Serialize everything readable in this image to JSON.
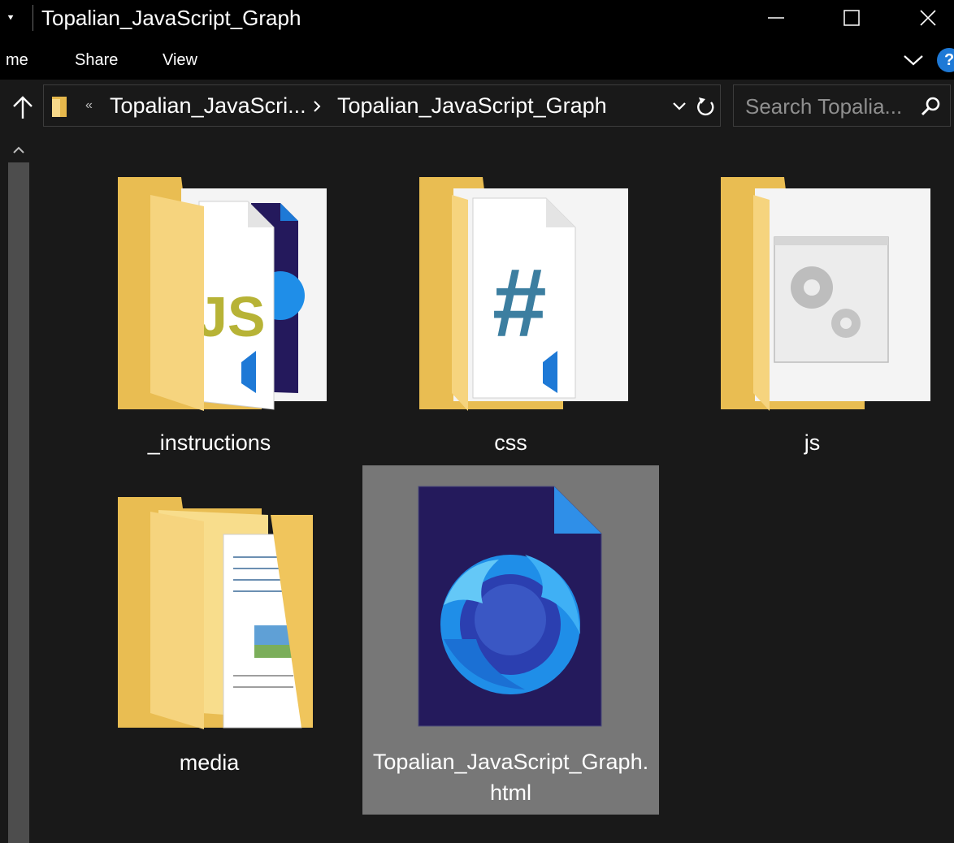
{
  "window": {
    "title": "Topalian_JavaScript_Graph",
    "quick_access_glyph": "⯆"
  },
  "ribbon": {
    "tabs": [
      "me",
      "Share",
      "View"
    ],
    "help_label": "?"
  },
  "address": {
    "overflow_glyph": "«",
    "crumbs": [
      "Topalian_JavaScri...",
      "Topalian_JavaScript_Graph"
    ]
  },
  "search": {
    "placeholder": "Search Topalia..."
  },
  "items": [
    {
      "label": "_instructions",
      "type": "folder",
      "icon": "folder-with-js-file-icon",
      "selected": false
    },
    {
      "label": "css",
      "type": "folder",
      "icon": "folder-with-css-file-icon",
      "selected": false
    },
    {
      "label": "js",
      "type": "folder",
      "icon": "folder-with-gears-icon",
      "selected": false
    },
    {
      "label": "media",
      "type": "folder",
      "icon": "folder-with-documents-icon",
      "selected": false
    },
    {
      "label_line1": "Topalian_JavaScript_Graph.",
      "label_line2": "html",
      "type": "file",
      "icon": "firefox-html-file-icon",
      "selected": true
    }
  ],
  "colors": {
    "titlebar": "#000000",
    "background": "#191919",
    "folder": "#f3d47c",
    "folder_dark": "#e6b84c",
    "selection": "#777777",
    "accent_blue": "#1e79d6"
  }
}
